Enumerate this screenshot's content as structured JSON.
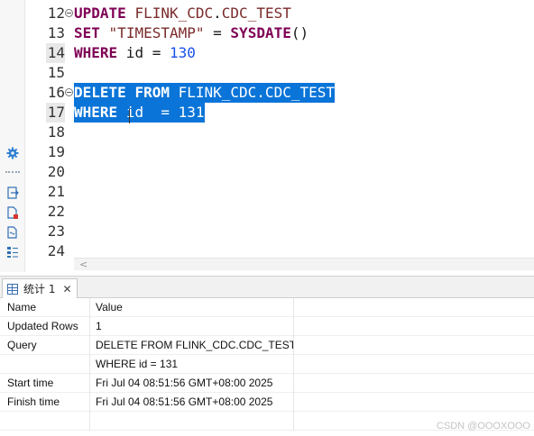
{
  "editor": {
    "lines": [
      {
        "num": "12",
        "fold": true,
        "mark": false,
        "tokens": [
          {
            "t": "UPDATE",
            "c": "kw"
          },
          {
            "t": " ",
            "c": "id"
          },
          {
            "t": "FLINK_CDC",
            "c": "ident"
          },
          {
            "t": ".",
            "c": "id"
          },
          {
            "t": "CDC_TEST",
            "c": "ident"
          }
        ],
        "selected": false
      },
      {
        "num": "13",
        "fold": false,
        "mark": false,
        "tokens": [
          {
            "t": "SET",
            "c": "kw"
          },
          {
            "t": " ",
            "c": "id"
          },
          {
            "t": "\"TIMESTAMP\"",
            "c": "ident"
          },
          {
            "t": " = ",
            "c": "id"
          },
          {
            "t": "SYSDATE",
            "c": "kw"
          },
          {
            "t": "()",
            "c": "id"
          }
        ],
        "selected": false
      },
      {
        "num": "14",
        "fold": false,
        "mark": true,
        "tokens": [
          {
            "t": "WHERE",
            "c": "kw"
          },
          {
            "t": " id = ",
            "c": "id"
          },
          {
            "t": "130",
            "c": "num"
          }
        ],
        "selected": false
      },
      {
        "num": "15",
        "fold": false,
        "mark": false,
        "tokens": [],
        "selected": false
      },
      {
        "num": "16",
        "fold": true,
        "mark": false,
        "tokens": [
          {
            "t": "DELETE",
            "c": "kw"
          },
          {
            "t": " ",
            "c": "id"
          },
          {
            "t": "FROM",
            "c": "kw"
          },
          {
            "t": " FLINK_CDC.CDC_TEST",
            "c": "id"
          }
        ],
        "selected": true
      },
      {
        "num": "17",
        "fold": false,
        "mark": true,
        "tokens": [
          {
            "t": "WHERE",
            "c": "kw"
          },
          {
            "t": " id  = ",
            "c": "id"
          },
          {
            "t": "131",
            "c": "num"
          }
        ],
        "selected": true
      },
      {
        "num": "18",
        "fold": false,
        "mark": false,
        "tokens": [],
        "selected": false
      },
      {
        "num": "19",
        "fold": false,
        "mark": false,
        "tokens": [],
        "selected": false
      },
      {
        "num": "20",
        "fold": false,
        "mark": false,
        "tokens": [],
        "selected": false
      },
      {
        "num": "21",
        "fold": false,
        "mark": false,
        "tokens": [],
        "selected": false
      },
      {
        "num": "22",
        "fold": false,
        "mark": false,
        "tokens": [],
        "selected": false
      },
      {
        "num": "23",
        "fold": false,
        "mark": false,
        "tokens": [],
        "selected": false
      },
      {
        "num": "24",
        "fold": false,
        "mark": false,
        "tokens": [],
        "selected": false
      }
    ],
    "toolbar_icons": [
      "gear-icon",
      "export-icon",
      "file-error-icon",
      "variable-file-icon",
      "outline-icon"
    ]
  },
  "results": {
    "tab_label": "统计 1",
    "tab_close": "✕",
    "columns": [
      "Name",
      "Value"
    ],
    "rows": [
      [
        "Updated Rows",
        "1"
      ],
      [
        "Query",
        "DELETE FROM FLINK_CDC.CDC_TEST"
      ],
      [
        "",
        "WHERE id  = 131"
      ],
      [
        "Start time",
        "Fri Jul 04 08:51:56 GMT+08:00 2025"
      ],
      [
        "Finish time",
        "Fri Jul 04 08:51:56 GMT+08:00 2025"
      ]
    ]
  },
  "watermark": "CSDN @OOOXOOO"
}
